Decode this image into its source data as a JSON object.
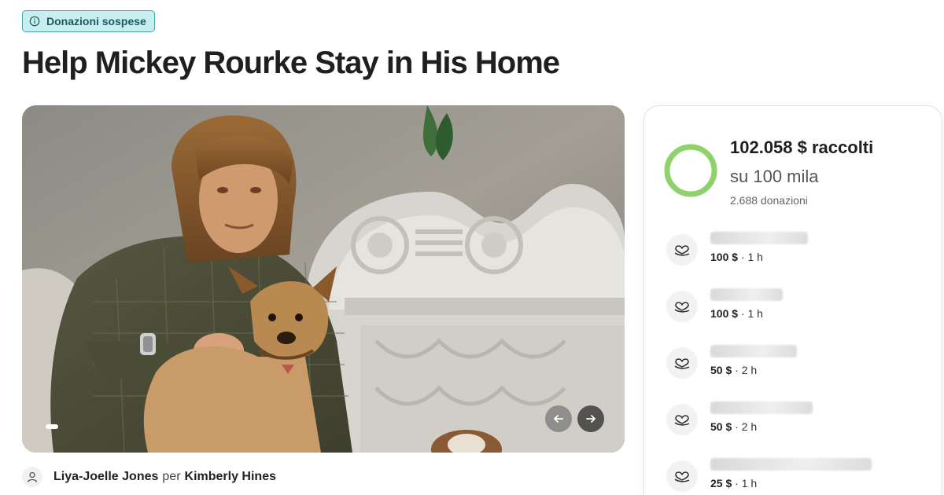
{
  "status_badge": {
    "label": "Donazioni sospese",
    "icon": "info-icon"
  },
  "title": "Help Mickey Rourke Stay in His Home",
  "hero": {
    "image_description_icon": "campaign-photo",
    "carousel": {
      "active_index": 0,
      "prev_icon": "arrow-left-icon",
      "next_icon": "arrow-right-icon"
    }
  },
  "organizer": {
    "name": "Liya-Joelle Jones",
    "joiner": "per",
    "beneficiary": "Kimberly Hines",
    "icon": "person-icon"
  },
  "fundraiser": {
    "raised": "102.058 $ raccolti",
    "goal": "su 100 mila",
    "donations_count": "2.688 donazioni",
    "progress_fraction": 1.0,
    "ring_color": "#8fd16a",
    "ring_track_color": "#dff3d2"
  },
  "donations": [
    {
      "amount": "100 $",
      "time": "1 h",
      "icon": "heart-hand-icon"
    },
    {
      "amount": "100 $",
      "time": "1 h",
      "icon": "heart-hand-icon"
    },
    {
      "amount": "50 $",
      "time": "2 h",
      "icon": "heart-hand-icon"
    },
    {
      "amount": "50 $",
      "time": "2 h",
      "icon": "heart-hand-icon"
    },
    {
      "amount": "25 $",
      "time": "1 h",
      "icon": "heart-hand-icon"
    }
  ],
  "colors": {
    "badge_bg": "#c9eef0",
    "badge_border": "#49a4ac",
    "badge_text": "#1b5a60",
    "progress_green": "#8fd16a"
  }
}
